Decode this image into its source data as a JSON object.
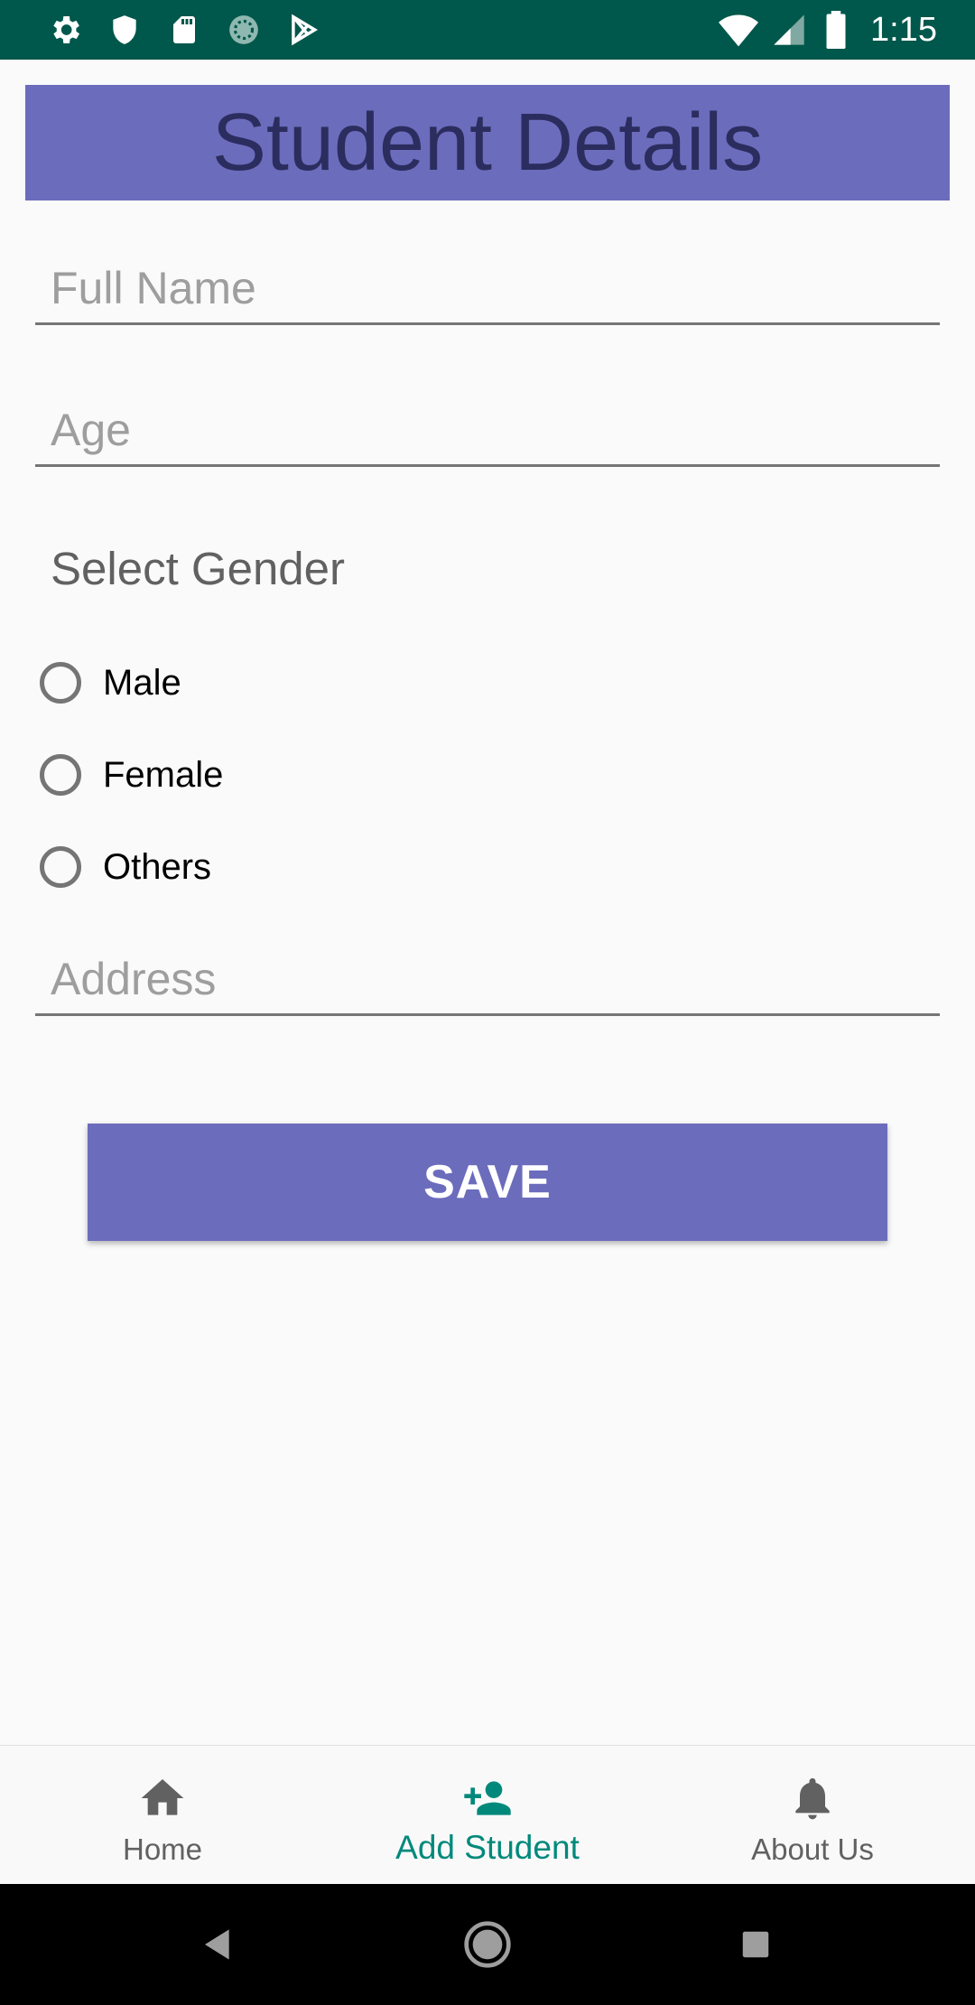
{
  "status_bar": {
    "time": "1:15",
    "left_icons": [
      "gear-icon",
      "shield-icon",
      "sd-card-icon",
      "sync-icon",
      "play-store-icon"
    ],
    "right_icons": [
      "wifi-icon",
      "signal-icon",
      "battery-icon"
    ],
    "background": "#00574b"
  },
  "header": {
    "title": "Student Details",
    "background": "#6c6cbd",
    "text_color": "#2b2d5e"
  },
  "form": {
    "full_name_placeholder": "Full Name",
    "full_name_value": "",
    "age_placeholder": "Age",
    "age_value": "",
    "gender_label": "Select Gender",
    "gender_options": [
      "Male",
      "Female",
      "Others"
    ],
    "address_placeholder": "Address",
    "address_value": ""
  },
  "save_button": {
    "label": "SAVE",
    "background": "#6c6cbd"
  },
  "bottom_nav": {
    "items": [
      {
        "label": "Home",
        "icon": "home-icon",
        "active": false
      },
      {
        "label": "Add Student",
        "icon": "add-person-icon",
        "active": true
      },
      {
        "label": "About Us",
        "icon": "bell-icon",
        "active": false
      }
    ],
    "active_color": "#00897b"
  },
  "system_nav": {
    "buttons": [
      "back-icon",
      "home-circle-icon",
      "recents-icon"
    ]
  }
}
